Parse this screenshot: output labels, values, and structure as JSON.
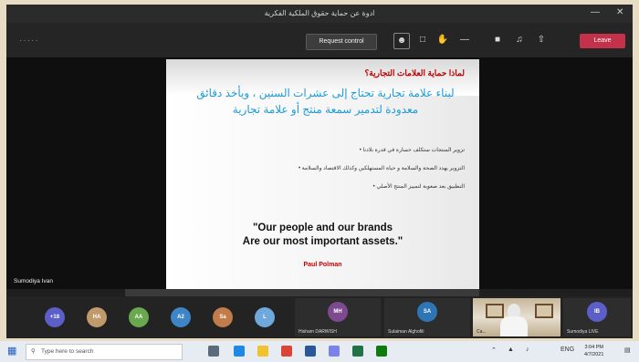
{
  "window": {
    "title": "ادوة عن حماية حقوق الملكية الفكرية",
    "minimize": "—",
    "close": "✕"
  },
  "toolbar": {
    "overflow_dots": "·····",
    "request_control": "Request control",
    "leave": "Leave",
    "icons": [
      "participants-icon",
      "chat-icon",
      "raise-hand-icon",
      "more-icon",
      "camera-icon",
      "mic-icon",
      "share-icon"
    ]
  },
  "slide": {
    "title": "لماذا حماية العلامات التجارية؟",
    "subtitle": "لبناء علامة تجارية تحتاج إلى عشرات السنين ، ويأخذ دقائق معدودة لتدمير سمعة منتج أو علامة تجارية",
    "bullets": [
      "تزوير المنتجات ستكلف خسارة في قدرة بلادنا",
      "التزوير يهدد الصحة والسلامة و حياة المستهلكين وكذلك الاقتصاد والسلامة",
      "التطبيق بعد صعوبة لتمييز المنتج الأصلي"
    ],
    "quote_line1": "\"Our people and our brands",
    "quote_line2": "Are our most important assets.\"",
    "author": "Paul Polman"
  },
  "presenter_name": "Sumodiya Ivan",
  "participants": {
    "avatars": [
      {
        "initials": "+18",
        "color": "#5b5fc7"
      },
      {
        "initials": "HA",
        "color": "#c19a6b"
      },
      {
        "initials": "AA",
        "color": "#6aa84f"
      },
      {
        "initials": "A2",
        "color": "#3d85c6"
      },
      {
        "initials": "Sa",
        "color": "#c27c4a"
      },
      {
        "initials": "L",
        "color": "#6fa8dc"
      }
    ],
    "tiles": [
      {
        "initials": "MH",
        "color": "#7e4a8f",
        "label": "Hisham DARWISH"
      },
      {
        "initials": "SA",
        "color": "#2e75b6",
        "label": "Sulaiman Alghofili"
      },
      {
        "initials": "IB",
        "color": "#5b5fc7",
        "label": "Sumodiya LIVE"
      }
    ],
    "video_label": "Ca..."
  },
  "taskbar": {
    "search_placeholder": "Type here to search",
    "time": "3:04 PM",
    "date": "4/7/2021",
    "lang": "ENG"
  }
}
